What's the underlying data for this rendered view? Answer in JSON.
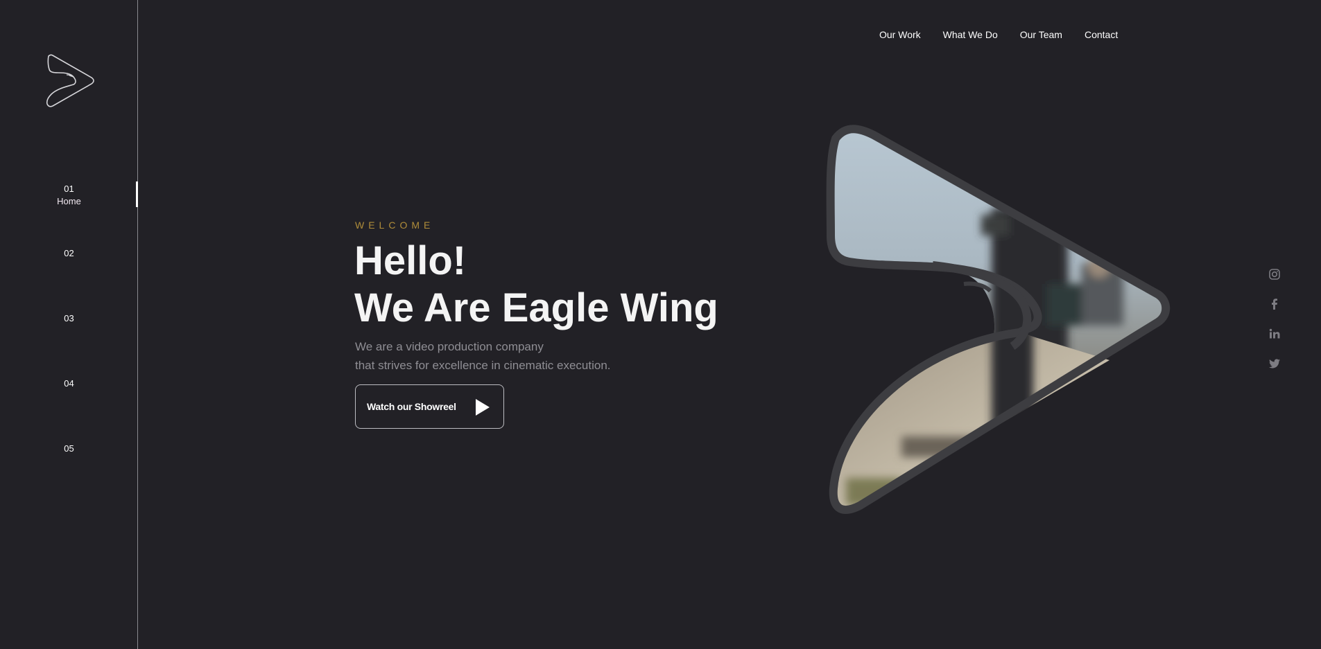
{
  "sidebar": {
    "items": [
      {
        "num": "01",
        "label": "Home"
      },
      {
        "num": "02",
        "label": ""
      },
      {
        "num": "03",
        "label": ""
      },
      {
        "num": "04",
        "label": ""
      },
      {
        "num": "05",
        "label": ""
      }
    ]
  },
  "nav": {
    "items": [
      "Our Work",
      "What We Do",
      "Our Team",
      "Contact"
    ]
  },
  "hero": {
    "eyebrow": "WELCOME",
    "title_line1": "Hello!",
    "title_line2": "We Are Eagle Wing",
    "sub_line1": "We are a video production company",
    "sub_line2": "that strives for excellence in cinematic execution.",
    "button_label": "Watch our Showreel"
  },
  "social": {
    "icons": [
      "instagram-icon",
      "facebook-icon",
      "linkedin-icon",
      "twitter-icon"
    ]
  },
  "colors": {
    "background": "#222126",
    "accent": "#b08d3a",
    "muted_text": "#8f8e94",
    "divider": "#8a8a8f"
  }
}
